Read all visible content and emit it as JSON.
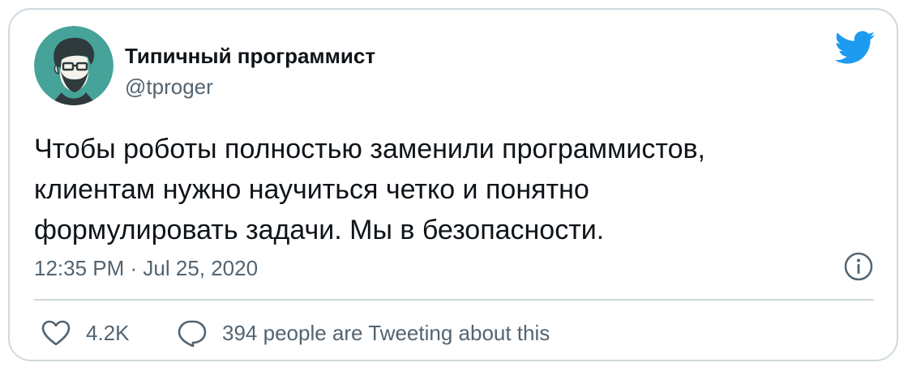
{
  "author": {
    "name": "Типичный программист",
    "handle": "@tproger",
    "avatar_icon": "bearded-programmer-avatar",
    "avatar_bg": "#46a399"
  },
  "tweet": {
    "lines": [
      "Чтобы роботы полностью заменили программистов,",
      "клиентам нужно научиться четко и понятно",
      "формулировать задачи. Мы в безопасности."
    ],
    "timestamp": "12:35 PM · Jul 25, 2020"
  },
  "actions": {
    "like_icon": "heart-icon",
    "like_count": "4.2K",
    "reply_icon": "speech-bubble-icon",
    "tweeting_text": "394 people are Tweeting about this"
  },
  "icons": {
    "brand": "twitter-bird-icon",
    "info": "info-icon"
  },
  "colors": {
    "brand_blue": "#1d9bf0",
    "text": "#0f1419",
    "secondary": "#536471",
    "border": "#cfd9de"
  }
}
